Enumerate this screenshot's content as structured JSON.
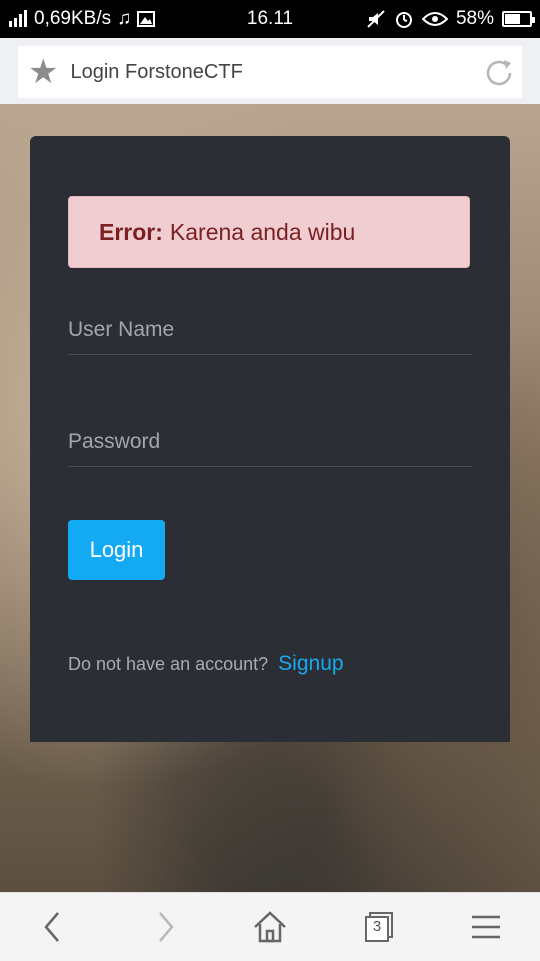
{
  "status_bar": {
    "network_speed": "0,69KB/s",
    "time": "16.11",
    "battery": "58%",
    "battery_level": 0.58
  },
  "browser": {
    "tab_title": "Login ForstoneCTF",
    "tabs_count": "3",
    "icons": {
      "favorite": "star-icon",
      "reload": "reload-icon",
      "back": "back-arrow-icon",
      "forward": "forward-arrow-icon",
      "home": "home-icon",
      "tabs": "tabs-icon",
      "menu": "menu-icon"
    }
  },
  "login": {
    "error_label": "Error:",
    "error_message": "Karena anda wibu",
    "username_placeholder": "User Name",
    "password_placeholder": "Password",
    "login_button": "Login",
    "signup_prompt": "Do not have an account?",
    "signup_link": "Signup"
  },
  "colors": {
    "card_bg": "#2b2e35",
    "alert_bg": "#efcdd1",
    "alert_text": "#7b1f23",
    "accent": "#13a9f3"
  }
}
